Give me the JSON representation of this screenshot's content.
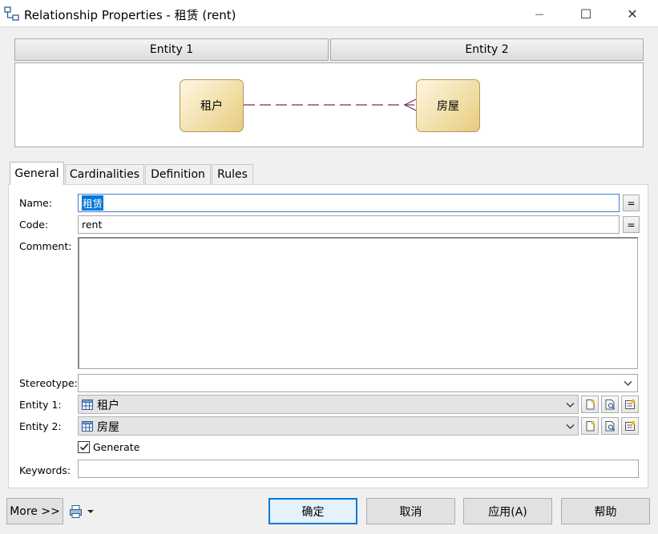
{
  "window": {
    "title": "Relationship Properties - 租赁 (rent)",
    "minimize_glyph": "—",
    "maximize_glyph": "☐",
    "close_glyph": "✕"
  },
  "header": {
    "entity1": "Entity 1",
    "entity2": "Entity 2"
  },
  "diagram": {
    "left_entity": "租户",
    "right_entity": "房屋"
  },
  "tabs": [
    {
      "label": "General",
      "active": true
    },
    {
      "label": "Cardinalities",
      "active": false
    },
    {
      "label": "Definition",
      "active": false
    },
    {
      "label": "Rules",
      "active": false
    }
  ],
  "form": {
    "name_label": "Name:",
    "name_value": "租赁",
    "code_label": "Code:",
    "code_value": "rent",
    "comment_label": "Comment:",
    "comment_value": "",
    "stereotype_label": "Stereotype:",
    "stereotype_value": "",
    "entity1_label": "Entity 1:",
    "entity1_value": "租户",
    "entity2_label": "Entity 2:",
    "entity2_value": "房屋",
    "generate_label": "Generate",
    "generate_checked": true,
    "keywords_label": "Keywords:",
    "keywords_value": "",
    "eq_button": "="
  },
  "footer": {
    "more": "More >>",
    "ok": "确定",
    "cancel": "取消",
    "apply": "应用(A)",
    "help": "帮助"
  },
  "colors": {
    "accent": "#0078d7",
    "entity_fill": "#f1dea6",
    "relation_line": "#7a2a5a"
  }
}
